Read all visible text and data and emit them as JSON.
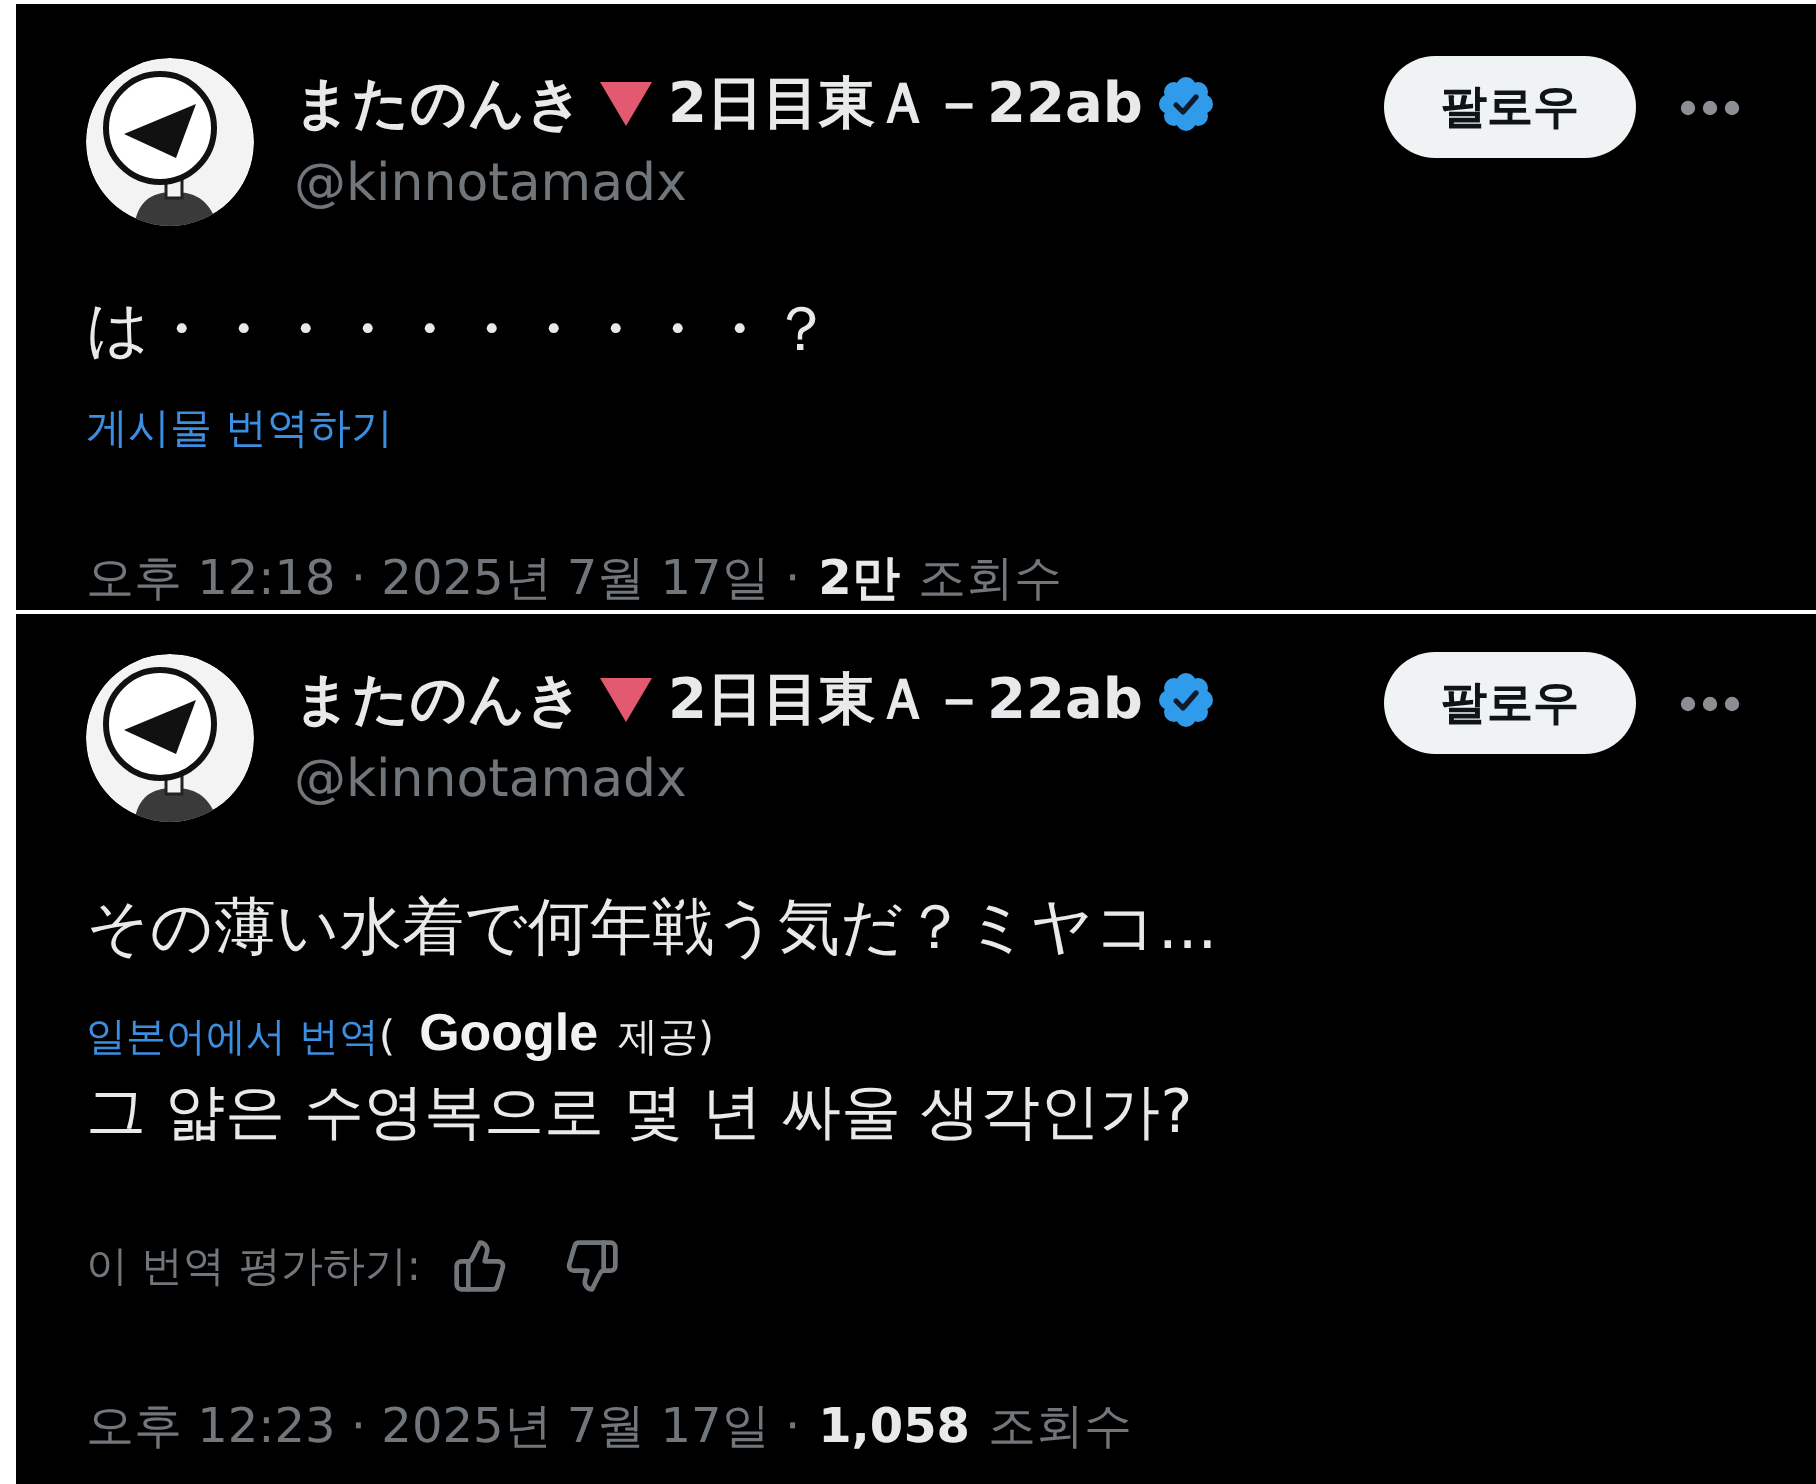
{
  "posts": [
    {
      "author": {
        "name_before_mark": "またのんき",
        "name_after_mark": "2日目東Ａ－22ab",
        "verified": true,
        "handle": "@kinnotamadx"
      },
      "follow_button": "팔로우",
      "text": "は・・・・・・・・・・？",
      "translate_link": "게시물 번역하기",
      "footer": {
        "timestamp": "오후 12:18 · 2025년 7월 17일 ·",
        "view_count": "2만",
        "view_label": "조회수"
      }
    },
    {
      "author": {
        "name_before_mark": "またのんき",
        "name_after_mark": "2日目東Ａ－22ab",
        "verified": true,
        "handle": "@kinnotamadx"
      },
      "follow_button": "팔로우",
      "text": "その薄い水着で何年戦う気だ？ミヤコ...",
      "translation": {
        "source_label": "일본어에서 번역",
        "open_paren": "(",
        "provider": "Google",
        "provider_suffix": "제공)",
        "text": "그 얇은 수영복으로 몇 년 싸울 생각인가?",
        "rate_label": "이 번역 평가하기:"
      },
      "footer": {
        "timestamp": "오후 12:23 · 2025년 7월 17일 ·",
        "view_count": "1,058",
        "view_label": "조회수"
      }
    }
  ]
}
